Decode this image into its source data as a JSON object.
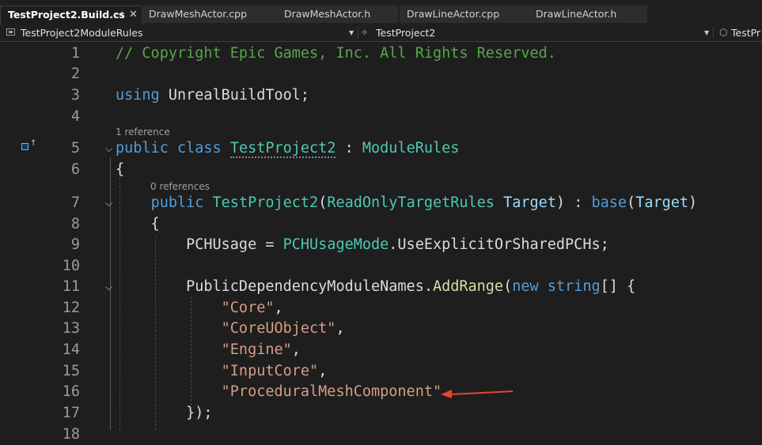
{
  "tabs": [
    {
      "label": "TestProject2.Build.cs",
      "active": true,
      "pin_icon": "pin-icon",
      "close_icon": "close-icon"
    },
    {
      "label": "DrawMeshActor.cpp",
      "active": false
    },
    {
      "label": "DrawMeshActor.h",
      "active": false
    },
    {
      "label": "DrawLineActor.cpp",
      "active": false
    },
    {
      "label": "DrawLineActor.h",
      "active": false
    }
  ],
  "tab_icons": {
    "pin": "⊣",
    "close": "✕"
  },
  "navbar": {
    "scope": "TestProject2ModuleRules",
    "type": "TestProject2",
    "member": "TestPr",
    "caret": "▼"
  },
  "editor": {
    "references": {
      "line5": "1 reference",
      "line7": "0 references"
    },
    "fold_glyph": "⌵",
    "marker_arrow": "↑",
    "lines": [
      {
        "n": "1",
        "tokens": [
          {
            "t": "// Copyright Epic Games, Inc. All Rights Reserved.",
            "c": "cm"
          }
        ]
      },
      {
        "n": "2",
        "tokens": []
      },
      {
        "n": "3",
        "tokens": [
          {
            "t": "using",
            "c": "kw"
          },
          {
            "t": " UnrealBuildTool;",
            "c": "pl"
          }
        ]
      },
      {
        "n": "4",
        "tokens": []
      },
      {
        "n": "5",
        "tokens": [
          {
            "t": "public",
            "c": "kw"
          },
          {
            "t": " ",
            "c": "pl"
          },
          {
            "t": "class",
            "c": "kw"
          },
          {
            "t": " ",
            "c": "pl"
          },
          {
            "t": "TestProject2",
            "c": "ty u"
          },
          {
            "t": " : ",
            "c": "pl"
          },
          {
            "t": "ModuleRules",
            "c": "ty"
          }
        ]
      },
      {
        "n": "6",
        "tokens": [
          {
            "t": "{",
            "c": "pl"
          }
        ]
      },
      {
        "n": "7",
        "tokens": [
          {
            "t": "    ",
            "c": "pl"
          },
          {
            "t": "public",
            "c": "kw"
          },
          {
            "t": " ",
            "c": "pl"
          },
          {
            "t": "TestProject2",
            "c": "ty"
          },
          {
            "t": "(",
            "c": "pl"
          },
          {
            "t": "ReadOnlyTargetRules",
            "c": "ty"
          },
          {
            "t": " ",
            "c": "pl"
          },
          {
            "t": "Target",
            "c": "pm"
          },
          {
            "t": ") : ",
            "c": "pl"
          },
          {
            "t": "base",
            "c": "kw"
          },
          {
            "t": "(",
            "c": "pl"
          },
          {
            "t": "Target",
            "c": "pm"
          },
          {
            "t": ")",
            "c": "pl"
          }
        ]
      },
      {
        "n": "8",
        "tokens": [
          {
            "t": "    {",
            "c": "pl"
          }
        ]
      },
      {
        "n": "9",
        "tokens": [
          {
            "t": "        PCHUsage = ",
            "c": "pl"
          },
          {
            "t": "PCHUsageMode",
            "c": "ty"
          },
          {
            "t": ".UseExplicitOrSharedPCHs;",
            "c": "pl"
          }
        ]
      },
      {
        "n": "10",
        "tokens": []
      },
      {
        "n": "11",
        "tokens": [
          {
            "t": "        PublicDependencyModuleNames.",
            "c": "pl"
          },
          {
            "t": "AddRange",
            "c": "fn"
          },
          {
            "t": "(",
            "c": "pl"
          },
          {
            "t": "new",
            "c": "kw"
          },
          {
            "t": " ",
            "c": "pl"
          },
          {
            "t": "string",
            "c": "kw"
          },
          {
            "t": "[] {",
            "c": "pl"
          }
        ]
      },
      {
        "n": "12",
        "tokens": [
          {
            "t": "            ",
            "c": "pl"
          },
          {
            "t": "\"Core\"",
            "c": "st"
          },
          {
            "t": ",",
            "c": "pl"
          }
        ]
      },
      {
        "n": "13",
        "tokens": [
          {
            "t": "            ",
            "c": "pl"
          },
          {
            "t": "\"CoreUObject\"",
            "c": "st"
          },
          {
            "t": ",",
            "c": "pl"
          }
        ]
      },
      {
        "n": "14",
        "tokens": [
          {
            "t": "            ",
            "c": "pl"
          },
          {
            "t": "\"Engine\"",
            "c": "st"
          },
          {
            "t": ",",
            "c": "pl"
          }
        ]
      },
      {
        "n": "15",
        "tokens": [
          {
            "t": "            ",
            "c": "pl"
          },
          {
            "t": "\"InputCore\"",
            "c": "st"
          },
          {
            "t": ",",
            "c": "pl"
          }
        ]
      },
      {
        "n": "16",
        "tokens": [
          {
            "t": "            ",
            "c": "pl"
          },
          {
            "t": "\"ProceduralMeshComponent\"",
            "c": "st"
          }
        ]
      },
      {
        "n": "17",
        "tokens": [
          {
            "t": "        });",
            "c": "pl"
          }
        ]
      },
      {
        "n": "18",
        "tokens": []
      }
    ]
  },
  "annotation": {
    "color": "#e8432f",
    "points_to_line": "16"
  }
}
